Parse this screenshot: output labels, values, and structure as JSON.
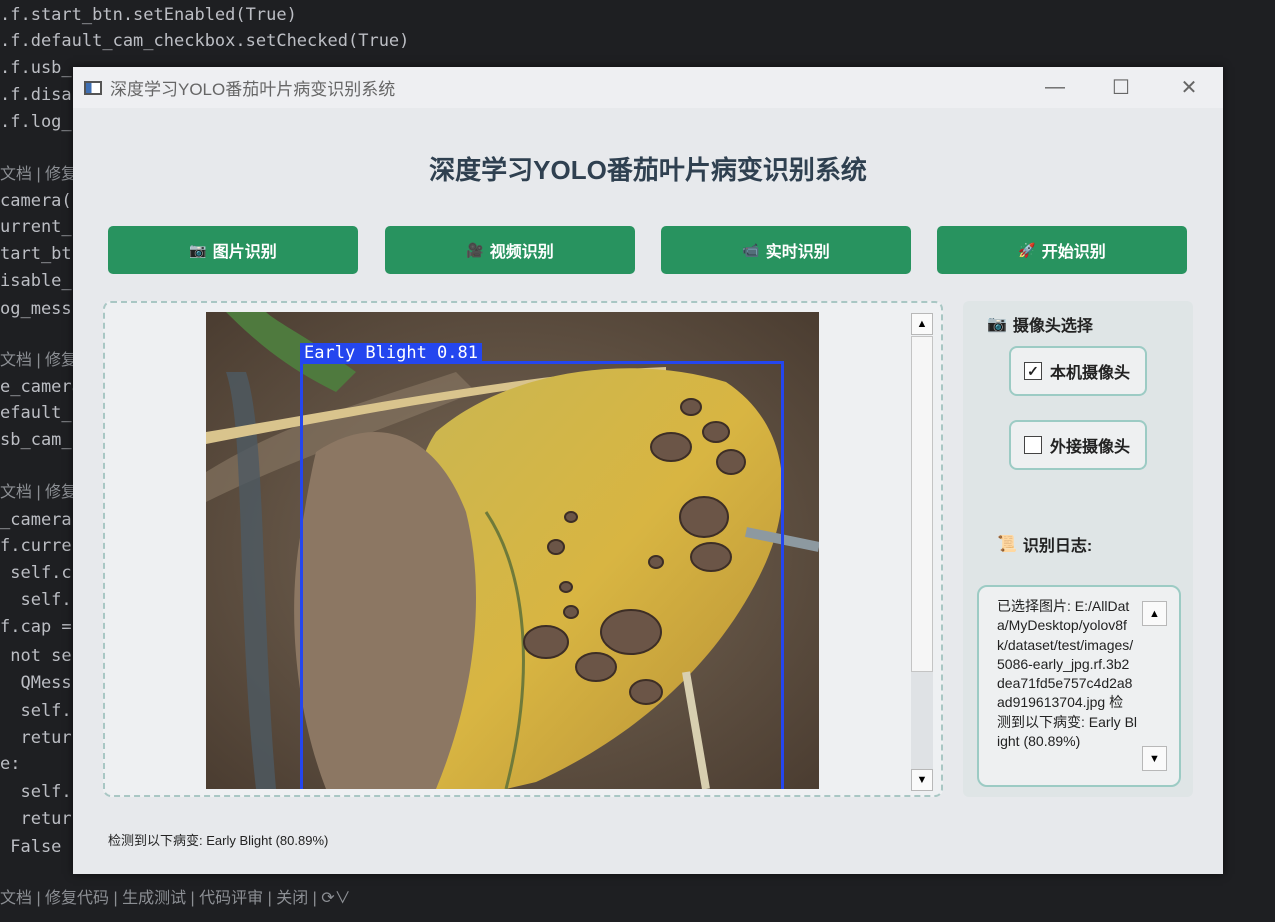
{
  "editor": {
    "lines": [
      {
        "t": ".f.start_btn.setEnabled(True)"
      },
      {
        "t": ".f.default_cam_checkbox.setChecked(True)"
      },
      {
        "t": ".f.usb_"
      },
      {
        "t": ".f.disa"
      },
      {
        "t": ".f.log_"
      },
      {
        "t": "文档 | 修复",
        "lens": true
      },
      {
        "t": "camera("
      },
      {
        "t": "urrent_"
      },
      {
        "t": "tart_bt"
      },
      {
        "t": "isable_"
      },
      {
        "t": "og_mess"
      },
      {
        "t": "文档 | 修复",
        "lens": true
      },
      {
        "t": "e_camera"
      },
      {
        "t": "efault_"
      },
      {
        "t": "sb_cam_"
      },
      {
        "t": "文档 | 修复",
        "lens": true
      },
      {
        "t": "_camera"
      },
      {
        "t": "f.curre"
      },
      {
        "t": " self.c"
      },
      {
        "t": "  self."
      },
      {
        "t": "f.cap ="
      },
      {
        "t": " not se"
      },
      {
        "t": "  QMess"
      },
      {
        "t": "  self."
      },
      {
        "t": "  retur"
      },
      {
        "t": "e:"
      },
      {
        "t": "  self."
      },
      {
        "t": "  retur"
      },
      {
        "t": " False"
      }
    ],
    "bottom_lens": "文档 | 修复代码 | 生成测试 | 代码评审 | 关闭 | ⟳∨"
  },
  "window": {
    "title": "深度学习YOLO番茄叶片病变识别系统",
    "minimize": "—",
    "maximize": "☐",
    "close": "✕"
  },
  "app": {
    "heading": "深度学习YOLO番茄叶片病变识别系统",
    "buttons": [
      {
        "icon": "📷",
        "label": "图片识别"
      },
      {
        "icon": "🎥",
        "label": "视频识别"
      },
      {
        "icon": "📹",
        "label": "实时识别"
      },
      {
        "icon": "🚀",
        "label": "开始识别"
      }
    ],
    "detection": {
      "label": "Early Blight 0.81",
      "color": "#2446ef"
    },
    "status_text": "检测到以下病变: Early Blight (80.89%)"
  },
  "side": {
    "camera_title": "摄像头选择",
    "camera_icon": "📷",
    "local_cam": {
      "label": "本机摄像头",
      "checked": true
    },
    "usb_cam": {
      "label": "外接摄像头",
      "checked": false
    },
    "log_title": "识别日志:",
    "log_icon": "📜",
    "log_text": "已选择图片: E:/AllData/MyDesktop/yolov8fk/dataset/test/images/5086-early_jpg.rf.3b2dea71fd5e757c4d2a8ad919613704.jpg 检测到以下病变: Early Blight (80.89%)"
  },
  "colors": {
    "accent": "#28935f",
    "panel_border": "#9ccbc4"
  }
}
